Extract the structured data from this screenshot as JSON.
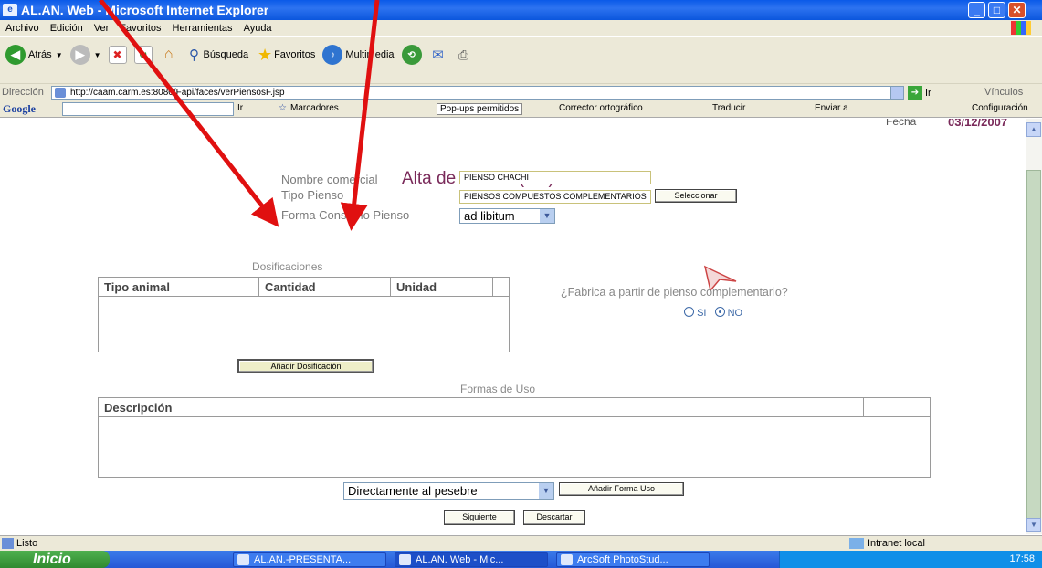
{
  "window": {
    "title": "AL.AN. Web - Microsoft Internet Explorer",
    "controls": {
      "minimize": "_",
      "maximize": "□",
      "close": "✕"
    }
  },
  "menu": [
    "Archivo",
    "Edición",
    "Ver",
    "Favoritos",
    "Herramientas",
    "Ayuda"
  ],
  "toolbar": {
    "back": "Atrás",
    "search": "Búsqueda",
    "favorites": "Favoritos",
    "multimedia": "Multimedia"
  },
  "address": {
    "label": "Dirección",
    "url": "http://caam.carm.es:8080/Fapi/faces/verPiensosF.jsp",
    "go": "Ir",
    "links": "Vínculos"
  },
  "googlebar": {
    "logo": "Google",
    "go": "Ir",
    "bookmarks": "Marcadores",
    "popups": "Pop-ups permitidos",
    "spell": "Corrector ortográfico",
    "translate": "Traducir",
    "send": "Enviar a",
    "config": "Configuración"
  },
  "page": {
    "fecha_label": "Fecha",
    "fecha_value": "03/12/2007",
    "title": "Alta de Pienso (1/3)",
    "nombre_label": "Nombre comercial",
    "nombre_value": "PIENSO CHACHI",
    "tipo_label": "Tipo Pienso",
    "tipo_value": "PIENSOS COMPUESTOS  COMPLEMENTARIOS",
    "seleccionar": "Seleccionar",
    "forma_label": "Forma Consumo Pienso",
    "forma_value": "ad libitum",
    "dosif_title": "Dosificaciones",
    "dosif_cols": [
      "Tipo animal",
      "Cantidad",
      "Unidad"
    ],
    "add_dosif": "Añadir Dosificación",
    "fabrica_question": "¿Fabrica a partir de pienso complementario?",
    "si": "SI",
    "no": "NO",
    "formas_title": "Formas de Uso",
    "formas_col": "Descripción",
    "uso_value": "Directamente al pesebre",
    "add_uso": "Añadir Forma Uso",
    "siguiente": "Siguiente",
    "descartar": "Descartar"
  },
  "status": {
    "text": "Listo",
    "zone": "Intranet local"
  },
  "taskbar": {
    "start": "Inicio",
    "tasks": [
      "AL.AN.-PRESENTA...",
      "AL.AN. Web - Mic...",
      "ArcSoft PhotoStud..."
    ],
    "clock": "17:58"
  },
  "colors": {
    "accent": "#7a2a5a",
    "annotation": "#e01010",
    "xp_blue": "#0a5ae8"
  }
}
